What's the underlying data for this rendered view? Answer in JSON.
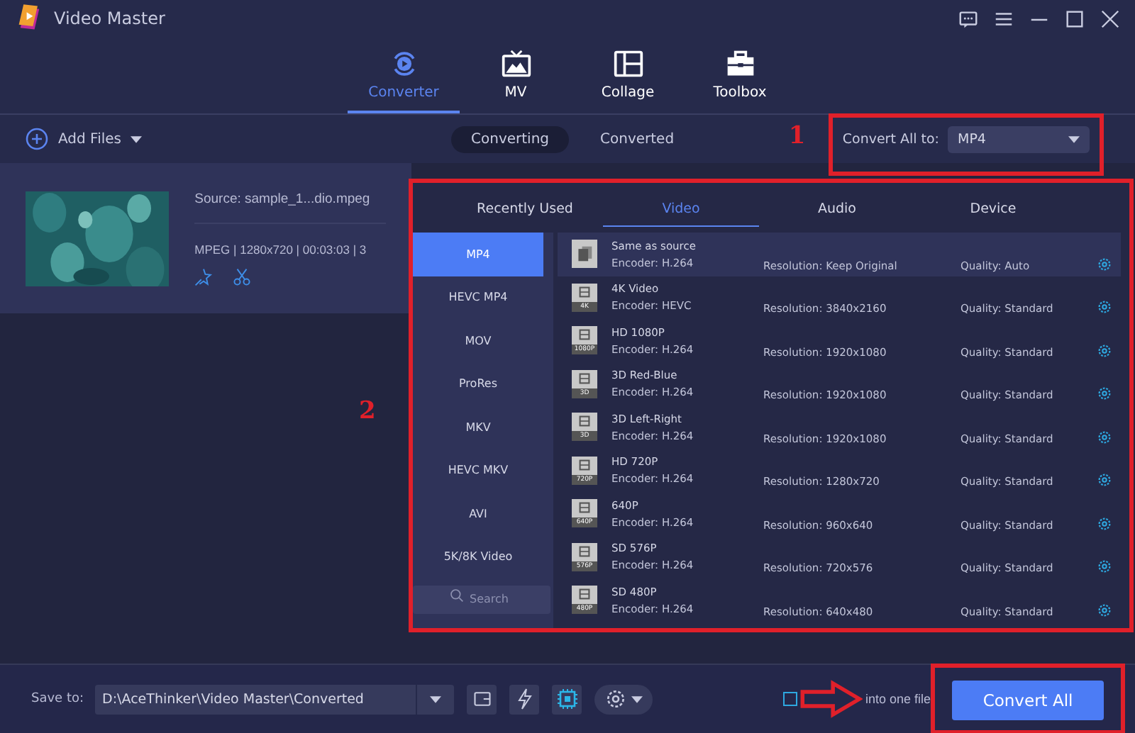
{
  "window": {
    "title": "Video Master"
  },
  "nav_tabs": [
    {
      "label": "Converter",
      "selected": true
    },
    {
      "label": "MV",
      "selected": false
    },
    {
      "label": "Collage",
      "selected": false
    },
    {
      "label": "Toolbox",
      "selected": false
    }
  ],
  "toolbar": {
    "add_files": "Add Files",
    "segments": [
      {
        "label": "Converting",
        "selected": true
      },
      {
        "label": "Converted",
        "selected": false
      }
    ],
    "convert_all_label": "Convert All to:",
    "convert_all_value": "MP4"
  },
  "file": {
    "source": "Source: sample_1...dio.mpeg",
    "info": "MPEG | 1280x720 | 00:03:03 | 3"
  },
  "format_panel": {
    "tabs": [
      {
        "label": "Recently Used",
        "selected": false
      },
      {
        "label": "Video",
        "selected": true
      },
      {
        "label": "Audio",
        "selected": false
      },
      {
        "label": "Device",
        "selected": false
      }
    ],
    "formats": [
      {
        "label": "MP4",
        "selected": true
      },
      {
        "label": "HEVC MP4",
        "selected": false
      },
      {
        "label": "MOV",
        "selected": false
      },
      {
        "label": "ProRes",
        "selected": false
      },
      {
        "label": "MKV",
        "selected": false
      },
      {
        "label": "HEVC MKV",
        "selected": false
      },
      {
        "label": "AVI",
        "selected": false
      },
      {
        "label": "5K/8K Video",
        "selected": false
      }
    ],
    "search_placeholder": "Search",
    "presets": [
      {
        "name": "Same as source",
        "encoder": "Encoder: H.264",
        "resolution": "Resolution: Keep Original",
        "quality": "Quality: Auto",
        "selected": true
      },
      {
        "name": "4K Video",
        "badge": "4K",
        "encoder": "Encoder: HEVC",
        "resolution": "Resolution: 3840x2160",
        "quality": "Quality: Standard",
        "selected": false
      },
      {
        "name": "HD 1080P",
        "badge": "1080P",
        "encoder": "Encoder: H.264",
        "resolution": "Resolution: 1920x1080",
        "quality": "Quality: Standard",
        "selected": false
      },
      {
        "name": "3D Red-Blue",
        "badge": "3D",
        "encoder": "Encoder: H.264",
        "resolution": "Resolution: 1920x1080",
        "quality": "Quality: Standard",
        "selected": false
      },
      {
        "name": "3D Left-Right",
        "badge": "3D",
        "encoder": "Encoder: H.264",
        "resolution": "Resolution: 1920x1080",
        "quality": "Quality: Standard",
        "selected": false
      },
      {
        "name": "HD 720P",
        "badge": "720P",
        "encoder": "Encoder: H.264",
        "resolution": "Resolution: 1280x720",
        "quality": "Quality: Standard",
        "selected": false
      },
      {
        "name": "640P",
        "badge": "640P",
        "encoder": "Encoder: H.264",
        "resolution": "Resolution: 960x640",
        "quality": "Quality: Standard",
        "selected": false
      },
      {
        "name": "SD 576P",
        "badge": "576P",
        "encoder": "Encoder: H.264",
        "resolution": "Resolution: 720x576",
        "quality": "Quality: Standard",
        "selected": false
      },
      {
        "name": "SD 480P",
        "badge": "480P",
        "encoder": "Encoder: H.264",
        "resolution": "Resolution: 640x480",
        "quality": "Quality: Standard",
        "selected": false
      }
    ]
  },
  "bottom_bar": {
    "save_to_label": "Save to:",
    "save_path": "D:\\AceThinker\\Video Master\\Converted",
    "merge_label": "into one file",
    "merge_checked": false,
    "convert_button": "Convert All"
  },
  "annotations": [
    {
      "label": "1"
    },
    {
      "label": "2"
    }
  ]
}
